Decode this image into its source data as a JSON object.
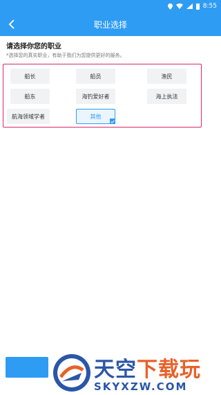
{
  "status_bar": {
    "time": "8:55"
  },
  "header": {
    "title": "职业选择",
    "back_icon": "chevron-left-icon"
  },
  "prompt": "请选择你您的职业",
  "hint": "*选择您的真实职业，有助于我们为您提供更好的服务。",
  "options": [
    {
      "label": "船长",
      "selected": false
    },
    {
      "label": "船员",
      "selected": false
    },
    {
      "label": "渔民",
      "selected": false
    },
    {
      "label": "船东",
      "selected": false
    },
    {
      "label": "海钓爱好者",
      "selected": false
    },
    {
      "label": "海上执法",
      "selected": false
    },
    {
      "label": "航海领域学者",
      "selected": false
    },
    {
      "label": "其他",
      "selected": true
    }
  ],
  "watermark": {
    "line1_a": "天空",
    "line1_b": "下载玩",
    "line2": "SKYXZW.COM"
  },
  "colors": {
    "accent": "#2f9cf4",
    "highlight_border": "#d6286b"
  }
}
